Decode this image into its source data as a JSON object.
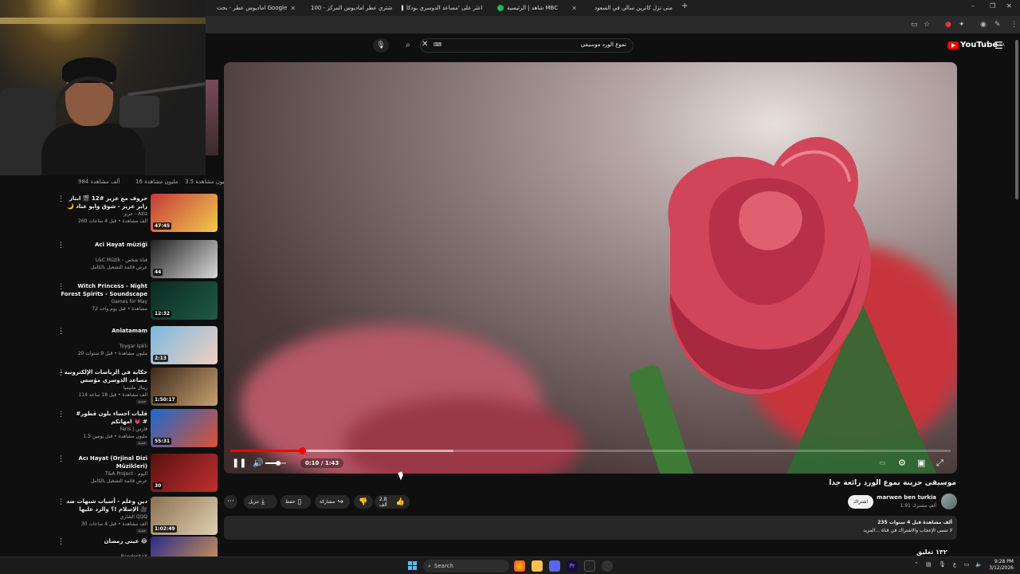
{
  "browser": {
    "tabs": [
      {
        "label": "اماديوس عطر - بحث Google"
      },
      {
        "label": "اشتري عطر اماديوس المركز - 100"
      },
      {
        "label": "اعثر على 'مساعد الدوسري بودكا"
      },
      {
        "label": "شاهد | الرئيسية MBC"
      },
      {
        "label": "متى تزل كاترين سالي في السعود"
      }
    ],
    "new_tab": "+",
    "window_controls": {
      "minimize": "–",
      "restore": "❐",
      "close": "✕"
    }
  },
  "youtube": {
    "logo_text": "YouTube",
    "region": "SA",
    "search": {
      "query": "نموع الورد موسيقى",
      "keyboard_icon": "⌨"
    }
  },
  "top_views": [
    {
      "text": "3.5 مليون مشاهدة"
    },
    {
      "text": "16 مليون مشاهدة"
    },
    {
      "text": "984 ألف مشاهدة"
    }
  ],
  "recommended": [
    {
      "title": "حروف مع عزيز #12 🎬 ابناز رابر عزيز - شوق وابو عناد 🌙 الموسم الثالث",
      "channel": "عزيز - Aziz",
      "meta": "260 ألف مشاهدة • قبل 4 ساعات",
      "duration": "47:45",
      "badge": "",
      "thumb": [
        "#c43a3a",
        "#f2c94c"
      ]
    },
    {
      "title": "Aci Hayat müziği",
      "channel": "L&C Müzik - قناة شخص",
      "meta": "عرض قائمة التشغيل بالكامل",
      "duration": "44",
      "badge": "",
      "thumb": [
        "#222",
        "#d9d9d9"
      ]
    },
    {
      "title": "Witch Princess - Night Forest Spirits - Soundscape in D - Live...",
      "channel": "Games for May",
      "meta": "72 مشاهدة • قبل يوم واحد",
      "duration": "12:32",
      "badge": "",
      "thumb": [
        "#0c2a22",
        "#1f5a45"
      ]
    },
    {
      "title": "Anlatamam",
      "channel": "Toygar Işıklı",
      "meta": "20 مليون مشاهدة • قبل 9 سنوات",
      "duration": "2:13",
      "badge": "",
      "thumb": [
        "#7ab8e0",
        "#f0d0c0"
      ]
    },
    {
      "title": "حكاية في الرياضات الإلكترونية - مساعد الدوسري مؤسس ورئيس فالكونز حديث ...",
      "channel": "ريتال ملتيميا",
      "meta": "114 ألف مشاهدة • قبل 18 ساعة",
      "duration": "1:50:17",
      "badge": "جديد",
      "thumb": [
        "#3a2a1a",
        "#c9a070"
      ]
    },
    {
      "title": "#قليات احساء بلون قطور امهاتكم 💗 #",
      "channel": "Faris | فارس",
      "meta": "1.5 مليون مشاهدة • قبل يومين",
      "duration": "55:31",
      "badge": "جديد",
      "thumb": [
        "#1a6ad0",
        "#e05030"
      ]
    },
    {
      "title": "Acı Hayat (Orjinal Dizi Müzikleri)",
      "channel": "T&A Project - ألبوم",
      "meta": "عرض قائمة التشغيل بالكامل",
      "duration": "30",
      "badge": "",
      "thumb": [
        "#5a1010",
        "#c03030"
      ]
    },
    {
      "title": "دين وعلم - أسباب شبهات ضد الإسلام !؟ والرد عليها 🎥",
      "channel": "الشاري QQQ",
      "meta": "30 ألف مشاهدة • قبل 4 ساعات",
      "duration": "1:02:49",
      "badge": "جديد",
      "thumb": [
        "#8a7050",
        "#e0d0b0"
      ]
    },
    {
      "title": "عيني رمضان 😂",
      "channel": "BanderitaX",
      "meta": "",
      "duration": "",
      "badge": "",
      "thumb": [
        "#2a2a8a",
        "#e0a050"
      ]
    }
  ],
  "player": {
    "current_time": "0:10",
    "duration": "1:43",
    "time_display": "0:10 / 1:43",
    "progress_fraction": 0.1,
    "loaded_fraction": 0.31,
    "volume_fraction": 0.6
  },
  "video": {
    "title": "موسيقى حزينة نموع الورد رائعة جدا",
    "channel_name": "marwen ben turkia",
    "subscribers": "1.91 ألف مشترك",
    "subscribe_label": "اشتراك",
    "like_count": "2.8 ألف",
    "share_label": "مشاركة",
    "save_label": "حفظ",
    "download_label": "تنزيل",
    "description_stats": "235 ألف مشاهدة  قبل 4 سنوات",
    "description_line": "لا تنسى الإعجاب والاشتراك في قناة ...المزيد",
    "comments_peek": "١٣٢ تعليق"
  },
  "taskbar": {
    "search_label": "Search",
    "lang": "ع",
    "time": "9:28 PM",
    "date": "3/12/2026"
  }
}
